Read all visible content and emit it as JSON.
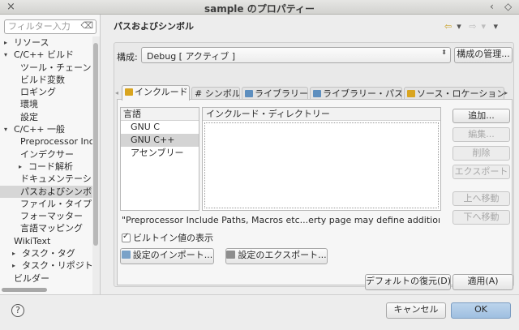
{
  "window": {
    "title": "sample のプロパティー",
    "controls": [
      "×",
      "‹",
      "◇"
    ]
  },
  "sidebar": {
    "filter_placeholder": "フィルター入力",
    "filter_clear_icon": "⌫",
    "tree": [
      {
        "label": "リソース",
        "arrow": "▸"
      },
      {
        "label": "C/C++ ビルド",
        "arrow": "▾"
      },
      {
        "label": "ツール・チェーン",
        "arrow": ""
      },
      {
        "label": "ビルド変数",
        "arrow": ""
      },
      {
        "label": "ロギング",
        "arrow": ""
      },
      {
        "label": "環境",
        "arrow": ""
      },
      {
        "label": "設定",
        "arrow": ""
      },
      {
        "label": "C/C++ 一般",
        "arrow": "▾"
      },
      {
        "label": "Preprocessor Inclu",
        "arrow": ""
      },
      {
        "label": "インデクサー",
        "arrow": ""
      },
      {
        "label": "コード解析",
        "arrow": "▸"
      },
      {
        "label": "ドキュメンテーシ",
        "arrow": ""
      },
      {
        "label": "パスおよびシンボ.",
        "arrow": ""
      },
      {
        "label": "ファイル・タイプ",
        "arrow": ""
      },
      {
        "label": "フォーマッター",
        "arrow": ""
      },
      {
        "label": "言語マッピング",
        "arrow": ""
      },
      {
        "label": "WikiText",
        "arrow": ""
      },
      {
        "label": "タスク・タグ",
        "arrow": "▸"
      },
      {
        "label": "タスク・リポジトリ",
        "arrow": "▸"
      },
      {
        "label": "ビルダー",
        "arrow": ""
      }
    ]
  },
  "content": {
    "page_title": "パスおよびシンボル",
    "nav_back": "⇦",
    "nav_back_menu": "▾",
    "nav_forward": "⇨",
    "nav_forward_menu": "▾",
    "nav_view_menu": "▾",
    "config_label": "構成:",
    "config_value": "Debug [ アクティブ ]",
    "config_updown": "⬍",
    "manage_button": "構成の管理...",
    "tab_scroll_left": "◂",
    "tab_scroll_right": "▸",
    "tabs": [
      {
        "label": "インクルード",
        "icon_color": "#d9a520"
      },
      {
        "label": "# シンボル",
        "icon_color": ""
      },
      {
        "label": "ライブラリー",
        "icon_color": "#5e8fbf"
      },
      {
        "label": "ライブラリー・パス",
        "icon_color": "#5e8fbf"
      },
      {
        "label": "ソース・ロケーション",
        "icon_color": "#d9a520"
      }
    ],
    "lang_header": "言語",
    "languages": [
      "GNU C",
      "GNU C++",
      "アセンブリー"
    ],
    "dir_header": "インクルード・ディレクトリー",
    "buttons": {
      "add": "追加...",
      "edit": "編集...",
      "delete": "削除",
      "export": "エクスポート",
      "move_up": "上へ移動",
      "move_down": "下へ移動"
    },
    "info_text": "\"Preprocessor Include Paths, Macros etc...erty page may define additional entries",
    "builtin_label": "ビルトイン値の表示",
    "import_button": "設定のインポート...",
    "export_button": "設定のエクスポート...",
    "restore_defaults": "デフォルトの復元(D)",
    "apply": "適用(A)"
  },
  "footer": {
    "help": "?",
    "cancel": "キャンセル",
    "ok": "OK"
  }
}
